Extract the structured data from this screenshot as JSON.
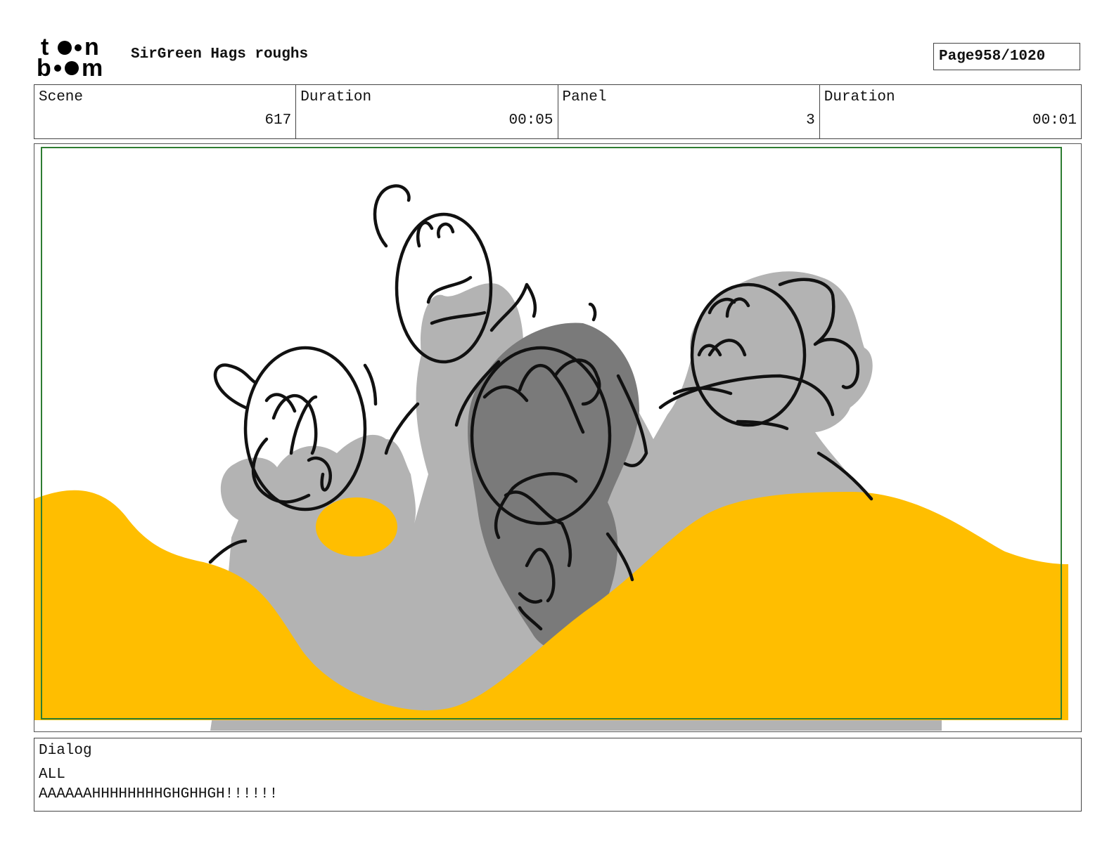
{
  "header": {
    "logo_text": "toon boom",
    "title": "SirGreen Hags roughs",
    "page_label": "Page",
    "page_value": "958/1020"
  },
  "info": {
    "scene_label": "Scene",
    "scene_value": "617",
    "duration_label": "Duration",
    "duration_value": "00:05",
    "panel_label": "Panel",
    "panel_value": "3",
    "panel_duration_label": "Duration",
    "panel_duration_value": "00:01"
  },
  "colors": {
    "safe_frame": "#2e7d32",
    "sand": "#ffbe00",
    "figure_light": "#b3b3b3",
    "figure_dark": "#7a7a7a",
    "ink": "#111111"
  },
  "dialog": {
    "label": "Dialog",
    "speaker": "ALL",
    "text": "AAAAAAHHHHHHHHGHGHHGH!!!!!!"
  }
}
